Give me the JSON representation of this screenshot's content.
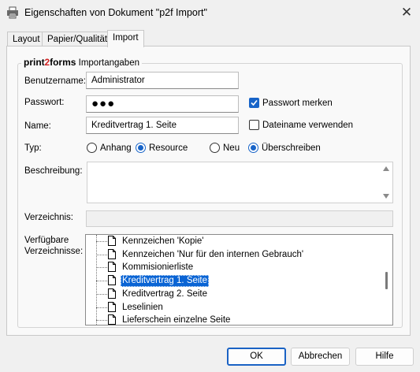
{
  "window": {
    "title": "Eigenschaften von Dokument \"p2f Import\"",
    "close_glyph": "✕"
  },
  "tabs": [
    {
      "label": "Layout"
    },
    {
      "label": "Papier/Qualität"
    },
    {
      "label": "Import"
    }
  ],
  "group": {
    "brand_prefix": "print",
    "brand_mid": "2",
    "brand_suffix": "forms",
    "label": "Importangaben"
  },
  "form": {
    "username_label": "Benutzername:",
    "username_value": "Administrator",
    "password_label": "Passwort:",
    "password_value": "●●●",
    "remember_password_label": "Passwort merken",
    "name_label": "Name:",
    "name_value": "Kreditvertrag 1. Seite",
    "use_filename_label": "Dateiname verwenden",
    "type_label": "Typ:",
    "type_options": [
      "Anhang",
      "Resource",
      "Neu",
      "Überschreiben"
    ],
    "description_label": "Beschreibung:",
    "directory_label": "Verzeichnis:",
    "available_dirs_label_1": "Verfügbare",
    "available_dirs_label_2": "Verzeichnisse:"
  },
  "tree_items": [
    "Kennzeichen 'Kopie'",
    "Kennzeichen 'Nur für den internen Gebrauch'",
    "Kommisionierliste",
    "Kreditvertrag 1. Seite",
    "Kreditvertrag 2. Seite",
    "Leselinien",
    "Lieferschein einzelne Seite"
  ],
  "buttons": {
    "ok": "OK",
    "cancel": "Abbrechen",
    "help": "Hilfe"
  },
  "colors": {
    "accent": "#1864c8",
    "selection": "#0a64d4",
    "brand_red": "#d21f1f"
  },
  "icons": {
    "app": "printer-icon",
    "close": "close-icon",
    "doc": "document-icon",
    "check": "checkmark-icon"
  }
}
